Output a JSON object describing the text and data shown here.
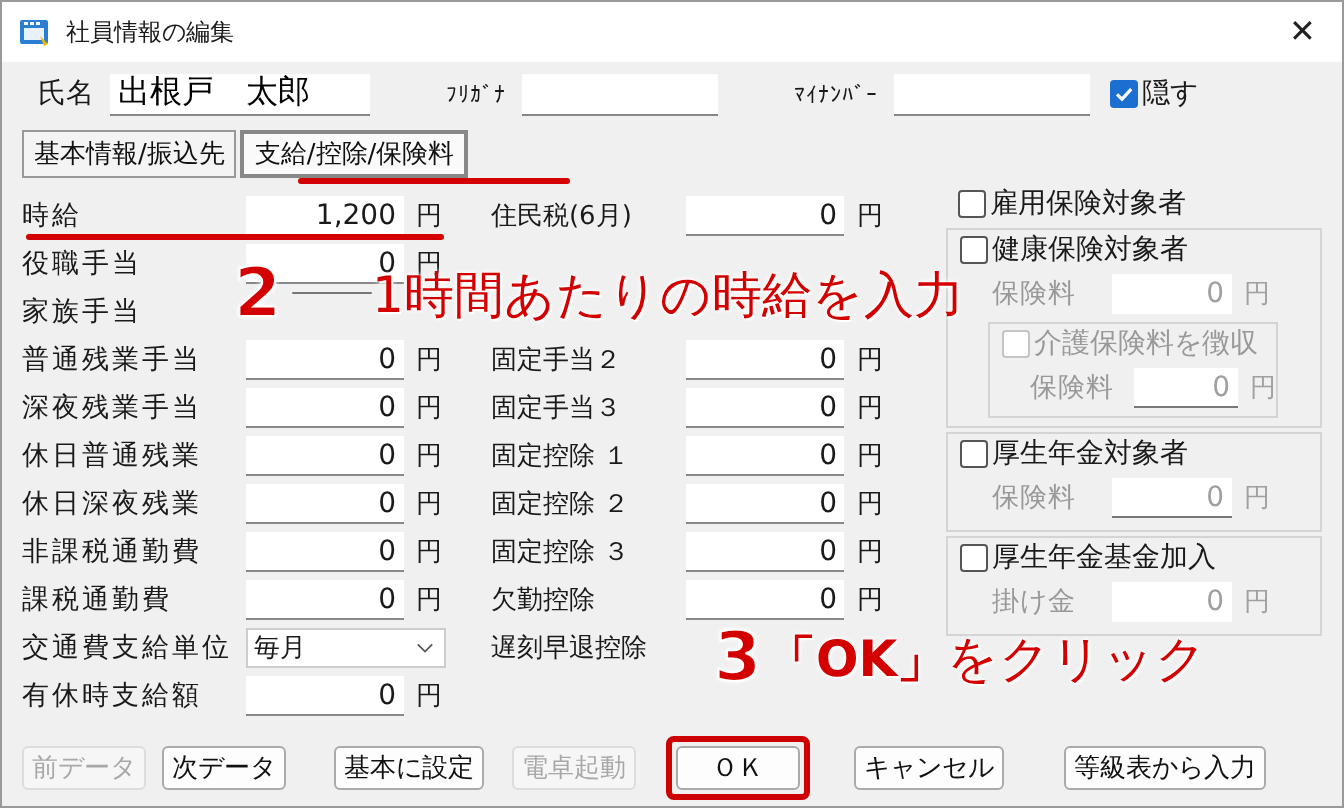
{
  "window": {
    "title": "社員情報の編集",
    "close": "✕"
  },
  "header": {
    "name_label": "氏名",
    "name_value": "出根戸　太郎",
    "furigana_label": "ﾌﾘｶﾞﾅ",
    "mynumber_label": "ﾏｲﾅﾝﾊﾞｰ",
    "hide": {
      "label": "隠す",
      "checked": true
    }
  },
  "tabs": [
    {
      "label": "基本情報/振込先",
      "selected": false
    },
    {
      "label": "支給/控除/保険料",
      "selected": true
    }
  ],
  "left_fields": [
    {
      "kind": "amount",
      "label": "時給",
      "value": "1,200",
      "unit": "円"
    },
    {
      "kind": "amount",
      "label": "役職手当",
      "value": "0",
      "unit": "円"
    },
    {
      "kind": "covered",
      "label": "家族手当"
    },
    {
      "kind": "amount",
      "label": "普通残業手当",
      "value": "0",
      "unit": "円"
    },
    {
      "kind": "amount",
      "label": "深夜残業手当",
      "value": "0",
      "unit": "円"
    },
    {
      "kind": "amount",
      "label": "休日普通残業",
      "value": "0",
      "unit": "円"
    },
    {
      "kind": "amount",
      "label": "休日深夜残業",
      "value": "0",
      "unit": "円"
    },
    {
      "kind": "amount",
      "label": "非課税通勤費",
      "value": "0",
      "unit": "円"
    },
    {
      "kind": "amount",
      "label": "課税通勤費",
      "value": "0",
      "unit": "円"
    },
    {
      "kind": "select",
      "label": "交通費支給単位",
      "value": "毎月"
    },
    {
      "kind": "amount",
      "label": "有休時支給額",
      "value": "0",
      "unit": "円"
    }
  ],
  "middle_fields": [
    {
      "kind": "amount",
      "label": "住民税(6月)",
      "value": "0",
      "unit": "円"
    },
    {
      "kind": "covered"
    },
    {
      "kind": "covered"
    },
    {
      "kind": "amount",
      "label": "固定手当２",
      "value": "0",
      "unit": "円"
    },
    {
      "kind": "amount",
      "label": "固定手当３",
      "value": "0",
      "unit": "円"
    },
    {
      "kind": "amount",
      "label": "固定控除 １",
      "value": "0",
      "unit": "円"
    },
    {
      "kind": "amount",
      "label": "固定控除 ２",
      "value": "0",
      "unit": "円"
    },
    {
      "kind": "amount",
      "label": "固定控除 ３",
      "value": "0",
      "unit": "円"
    },
    {
      "kind": "amount",
      "label": "欠勤控除",
      "value": "0",
      "unit": "円"
    },
    {
      "kind": "covered",
      "label": "遅刻早退控除"
    }
  ],
  "insurance": {
    "employment": {
      "label": "雇用保険対象者",
      "checked": false
    },
    "health": {
      "label": "健康保険対象者",
      "checked": false,
      "fee_label": "保険料",
      "fee": "0",
      "unit": "円",
      "care": {
        "label": "介護保険料を徴収",
        "checked": false,
        "disabled": true,
        "fee_label": "保険料",
        "fee": "0",
        "unit": "円"
      }
    },
    "pension": {
      "label": "厚生年金対象者",
      "checked": false,
      "fee_label": "保険料",
      "fee": "0",
      "unit": "円"
    },
    "fund": {
      "label": "厚生年金基金加入",
      "checked": false,
      "fee_label": "掛け金",
      "fee": "0",
      "unit": "円"
    }
  },
  "buttons": [
    {
      "label": "前データ",
      "disabled": true,
      "highlighted": false
    },
    {
      "label": "次データ",
      "disabled": false,
      "highlighted": false
    },
    {
      "label": "基本に設定",
      "disabled": false,
      "highlighted": false
    },
    {
      "label": "電卓起動",
      "disabled": true,
      "highlighted": false
    },
    {
      "label": "ＯＫ",
      "disabled": false,
      "highlighted": true
    },
    {
      "label": "キャンセル",
      "disabled": false,
      "highlighted": false
    },
    {
      "label": "等級表から入力",
      "disabled": false,
      "highlighted": false
    }
  ],
  "annotations": [
    {
      "kind": "step",
      "number": "2",
      "text": "1時間あたりの時給を入力"
    },
    {
      "kind": "step",
      "number": "3",
      "text": "**「OK」**をクリック"
    }
  ]
}
